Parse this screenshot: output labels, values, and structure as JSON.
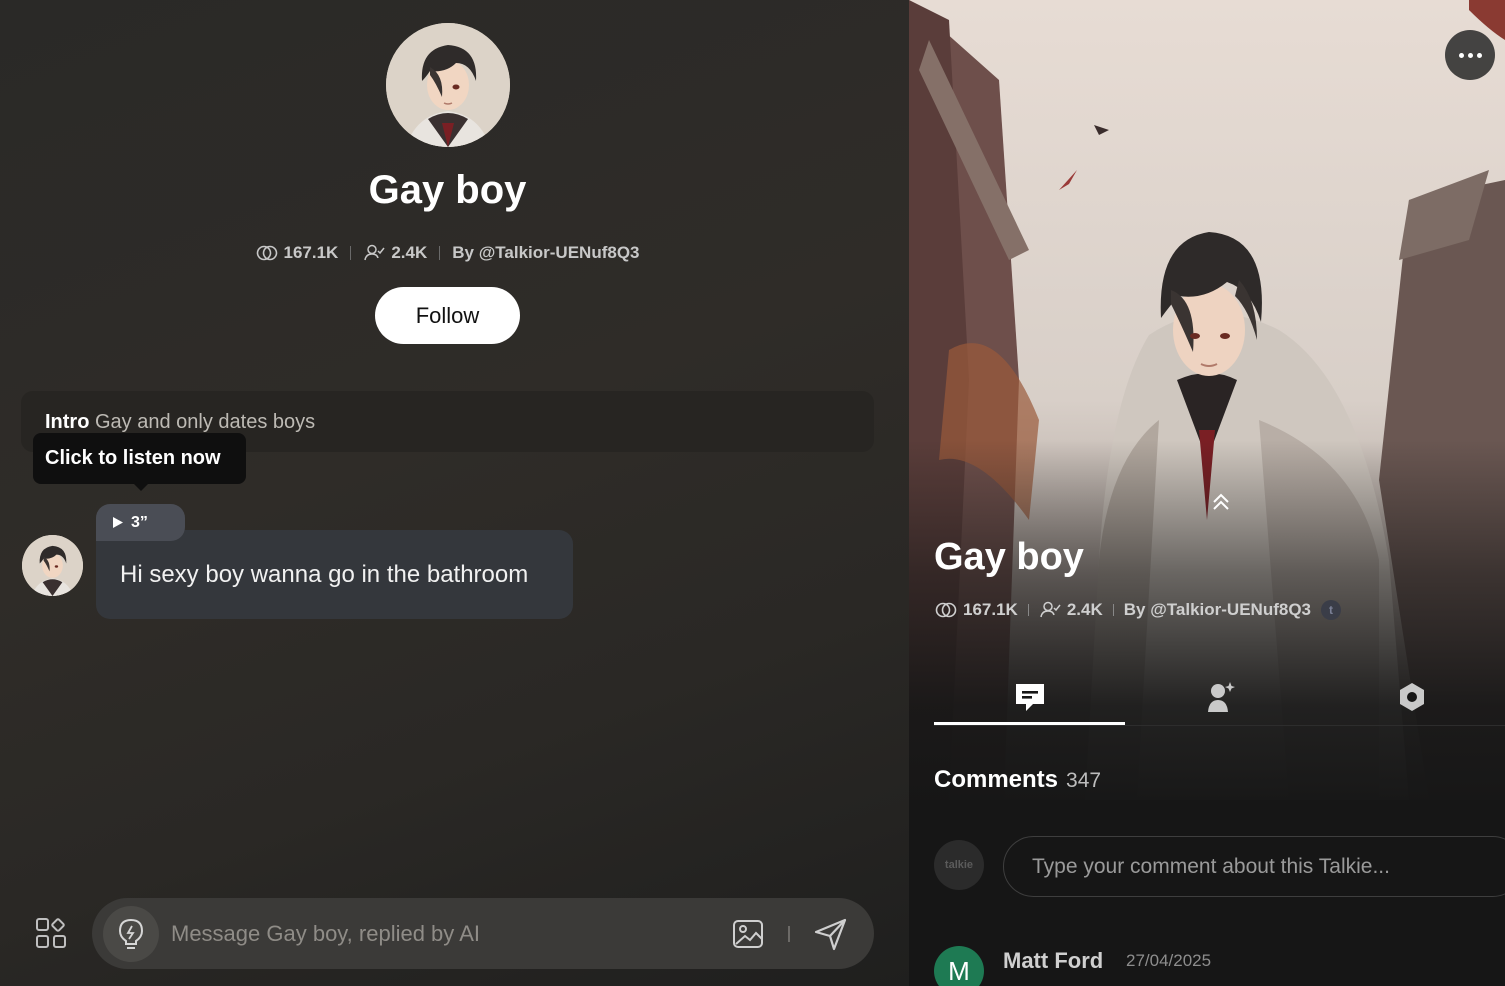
{
  "character": {
    "name": "Gay boy",
    "chats": "167.1K",
    "followers": "2.4K",
    "creator": "By @Talkior-UENuf8Q3"
  },
  "chat": {
    "follow_label": "Follow",
    "intro_label": "Intro",
    "intro_text": "Gay and only dates boys",
    "tooltip": "Click to listen now",
    "audio_duration": "3”",
    "message": "Hi sexy boy wanna go in the bathroom",
    "input_placeholder": "Message Gay boy, replied by AI"
  },
  "profile": {
    "title": "Gay boy",
    "chats": "167.1K",
    "followers": "2.4K",
    "creator": "By @Talkior-UENuf8Q3",
    "badge": "t",
    "tabs": [
      {
        "icon": "comment-icon",
        "active": true
      },
      {
        "icon": "character-sparkle-icon",
        "active": false
      },
      {
        "icon": "settings-hex-icon",
        "active": false
      }
    ],
    "comments_label": "Comments",
    "comments_count": "347",
    "self_avatar_text": "talkie",
    "comment_placeholder": "Type your comment about this Talkie...",
    "comments": [
      {
        "avatar_letter": "M",
        "author": "Matt Ford",
        "date": "27/04/2025",
        "avatar_color": "#1e7a53"
      }
    ]
  },
  "colors": {
    "accent_white": "#ffffff",
    "chat_bg": "#2d2b28",
    "bubble": "#34373c",
    "audio_pill": "#4a4d55"
  }
}
